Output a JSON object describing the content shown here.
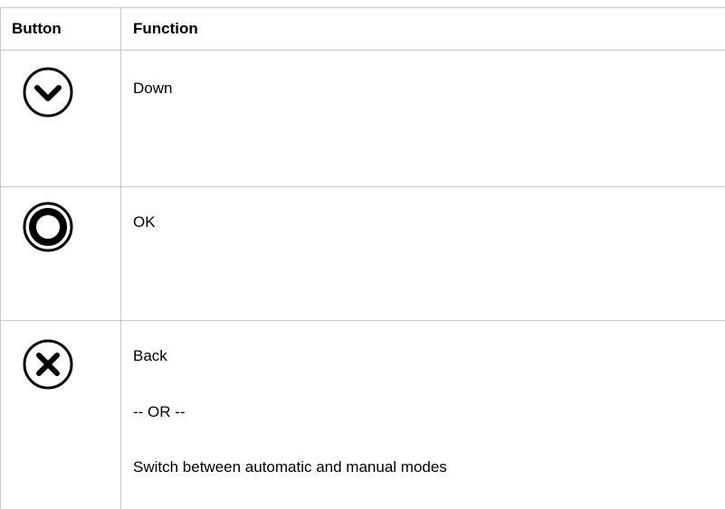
{
  "table": {
    "headers": {
      "button": "Button",
      "function": "Function"
    },
    "rows": [
      {
        "icon": "chevron-down-circle-icon",
        "lines": [
          "Down"
        ]
      },
      {
        "icon": "ok-ring-icon",
        "lines": [
          "OK"
        ]
      },
      {
        "icon": "close-circle-icon",
        "lines": [
          "Back",
          "-- OR --",
          "Switch between automatic and manual modes"
        ]
      }
    ]
  },
  "colors": {
    "border": "#c8c8c8",
    "text": "#000000",
    "icon": "#000000"
  }
}
